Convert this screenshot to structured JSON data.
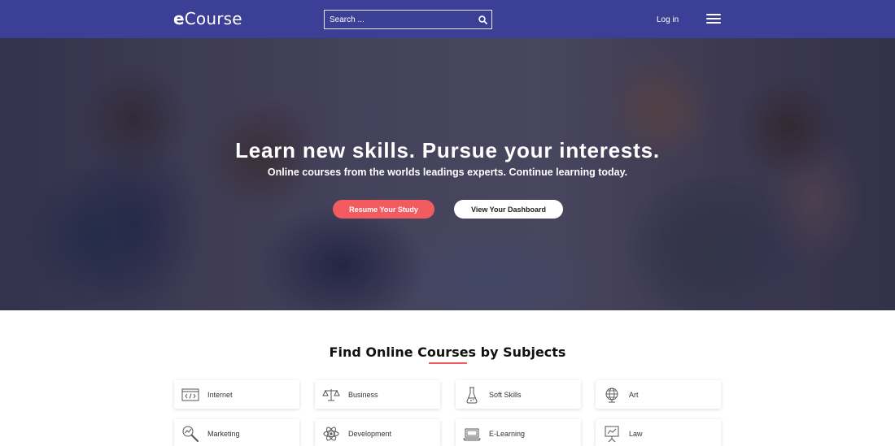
{
  "header": {
    "logo_first": "e",
    "logo_rest": "Course",
    "search_placeholder": "Search ...",
    "login_label": "Log in",
    "bar_color": "#3b3f95"
  },
  "hero": {
    "title": "Learn new skills. Pursue your interests.",
    "subtitle": "Online courses from the worlds leadings experts. Continue learning today.",
    "resume_label": "Resume Your Study",
    "dashboard_label": "View Your Dashboard",
    "accent_color": "#f25c61"
  },
  "subjects": {
    "title": "Find Online Courses by Subjects",
    "items": [
      {
        "label": "Internet",
        "icon": "code-window-icon"
      },
      {
        "label": "Business",
        "icon": "scales-icon"
      },
      {
        "label": "Soft Skills",
        "icon": "flask-icon"
      },
      {
        "label": "Art",
        "icon": "globe-icon"
      },
      {
        "label": "Marketing",
        "icon": "magnifier-chart-icon"
      },
      {
        "label": "Development",
        "icon": "atom-icon"
      },
      {
        "label": "E-Learning",
        "icon": "laptop-icon"
      },
      {
        "label": "Law",
        "icon": "presentation-board-icon"
      }
    ]
  }
}
